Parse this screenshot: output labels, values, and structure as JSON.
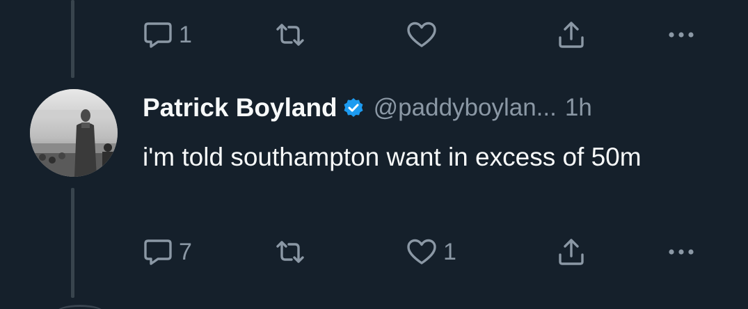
{
  "colors": {
    "background": "#15202b",
    "primary_text": "#f7f9f9",
    "secondary_text": "#8b98a5",
    "verified_badge": "#1d9bf0",
    "thread_line": "#38444d"
  },
  "previous_tweet": {
    "actions": {
      "reply": {
        "icon": "reply-icon",
        "count": "1"
      },
      "retweet": {
        "icon": "retweet-icon",
        "count": ""
      },
      "like": {
        "icon": "heart-icon",
        "count": ""
      },
      "share": {
        "icon": "share-icon"
      },
      "more": {
        "icon": "more-icon"
      }
    }
  },
  "tweet": {
    "author": {
      "display_name": "Patrick Boyland",
      "verified": true,
      "handle": "@paddyboylan...",
      "avatar_icon": "avatar-photo"
    },
    "time": "1h",
    "text": "i'm told southampton want in excess of 50m",
    "actions": {
      "reply": {
        "icon": "reply-icon",
        "count": "7"
      },
      "retweet": {
        "icon": "retweet-icon",
        "count": ""
      },
      "like": {
        "icon": "heart-icon",
        "count": "1"
      },
      "share": {
        "icon": "share-icon"
      },
      "more": {
        "icon": "more-icon"
      }
    }
  }
}
